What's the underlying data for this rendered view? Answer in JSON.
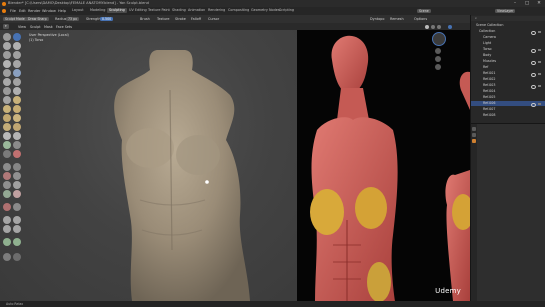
{
  "title_bar": {
    "title": "Blender* [C:\\Users\\DAMO\\Desktop\\FEMALE ANATOMY.blend] - Yan Sculpt.blend"
  },
  "menu": [
    "File",
    "Edit",
    "Render",
    "Window",
    "Help"
  ],
  "workspaces": [
    "Layout",
    "Modeling",
    "Sculpting",
    "UV Editing",
    "Texture Paint",
    "Shading",
    "Animation",
    "Rendering",
    "Compositing",
    "Geometry Nodes",
    "Scripting"
  ],
  "active_workspace": "Sculpting",
  "scene": {
    "label": "Scene",
    "view_layer": "ViewLayer"
  },
  "header": {
    "mode": "Sculpt Mode",
    "view": "View",
    "sculpt": "Sculpt",
    "mask": "Mask",
    "face_sets": "Face Sets",
    "brush_name": "Draw Sharp",
    "radius_label": "Radius",
    "radius_value": "73 px",
    "strength_label": "Strength",
    "strength_value": "0.500",
    "brush_menu": "Brush",
    "texture_menu": "Texture",
    "stroke_menu": "Stroke",
    "falloff_menu": "Falloff",
    "cursor_menu": "Cursor",
    "dyntopo": "Dyntopo",
    "remesh": "Remesh",
    "options": "Options"
  },
  "viewport": {
    "perspective": "User Perspective (Local)",
    "object": "(1) Torso"
  },
  "outliner": {
    "root": "Scene Collection",
    "rows": [
      "Collection",
      "Camera",
      "Light",
      "Torso",
      "Body",
      "Muscles",
      "Ref",
      "Ref.001",
      "Ref.002",
      "Ref.003",
      "Ref.004",
      "Ref.005",
      "Ref.006",
      "Ref.007",
      "Ref.008"
    ],
    "selected_index": 12
  },
  "watermark": "Udemy",
  "status": {
    "text": "Auto Relax"
  },
  "colors": {
    "accent": "#4772b3",
    "selected_row": "#334d80",
    "viewport_bg": "#404040"
  }
}
